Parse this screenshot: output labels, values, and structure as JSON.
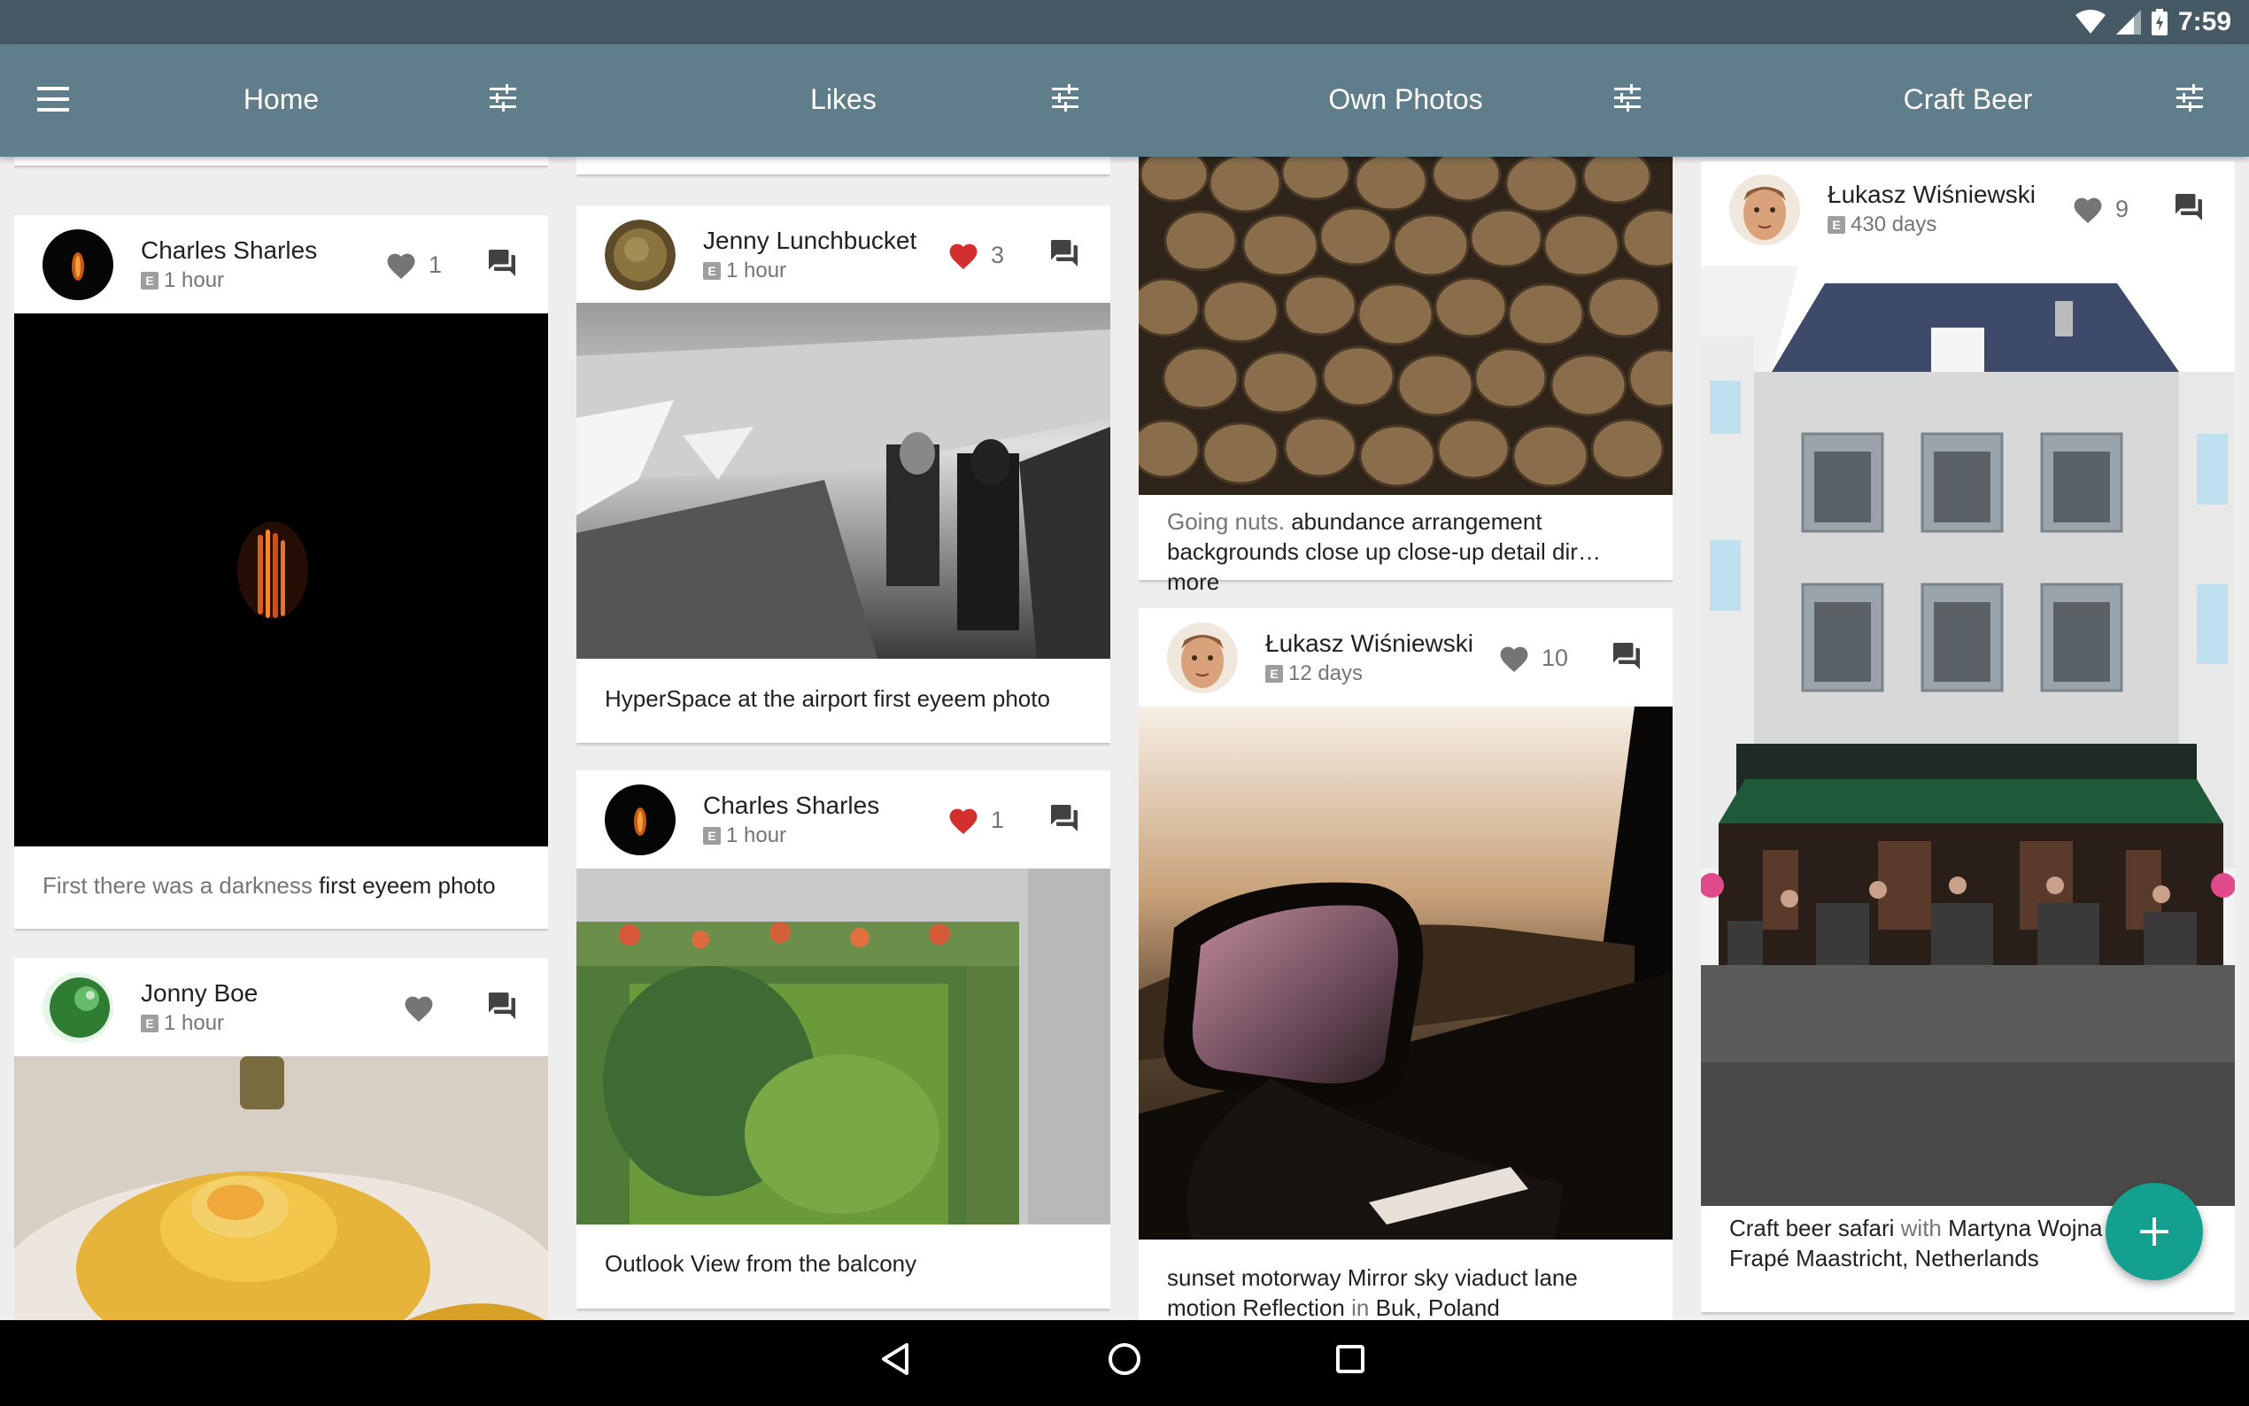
{
  "status_bar": {
    "time": "7:59",
    "icons": [
      "wifi-icon",
      "cell-signal-icon",
      "battery-icon"
    ]
  },
  "app_bar": {
    "menu_icon": "menu-icon",
    "columns": [
      {
        "title": "Home"
      },
      {
        "title": "Likes"
      },
      {
        "title": "Own Photos"
      },
      {
        "title": "Craft Beer"
      }
    ]
  },
  "feeds": {
    "home": [
      {
        "user": "Charles Sharles",
        "time": "1 hour",
        "likes": "1",
        "liked": false,
        "caption_muted": "First there was a darkness",
        "caption_main": "first eyeem photo"
      },
      {
        "user": "Jonny Boe",
        "time": "1 hour",
        "likes": "",
        "liked": false
      }
    ],
    "likes": [
      {
        "user": "Jenny Lunchbucket",
        "time": "1 hour",
        "likes": "3",
        "liked": true,
        "caption_main": "HyperSpace at the airport first eyeem photo"
      },
      {
        "user": "Charles Sharles",
        "time": "1 hour",
        "likes": "1",
        "liked": true,
        "caption_main": "Outlook View from the balcony"
      }
    ],
    "own_photos": [
      {
        "caption_muted": "Going nuts.",
        "caption_main": "abundance arrangement backgrounds close up close-up detail dir…more"
      },
      {
        "user": "Łukasz Wiśniewski",
        "time": "12 days",
        "likes": "10",
        "liked": false,
        "caption_main": "sunset motorway Mirror sky viaduct lane motion Reflection",
        "caption_in": "in",
        "caption_place": "Buk, Poland"
      }
    ],
    "craft_beer": [
      {
        "user": "Łukasz Wiśniewski",
        "time": "430 days",
        "likes": "9",
        "liked": false,
        "caption_main": "Craft beer safari",
        "caption_with": "with",
        "caption_person": "Martyna Wojna",
        "caption_line2": "Frapé Maastricht, Netherlands"
      }
    ]
  },
  "fab": {
    "icon": "add-icon"
  },
  "colors": {
    "status_bar": "#455a64",
    "app_bar": "#607d8b",
    "liked": "#d32f2f",
    "fab": "#14a08e"
  }
}
